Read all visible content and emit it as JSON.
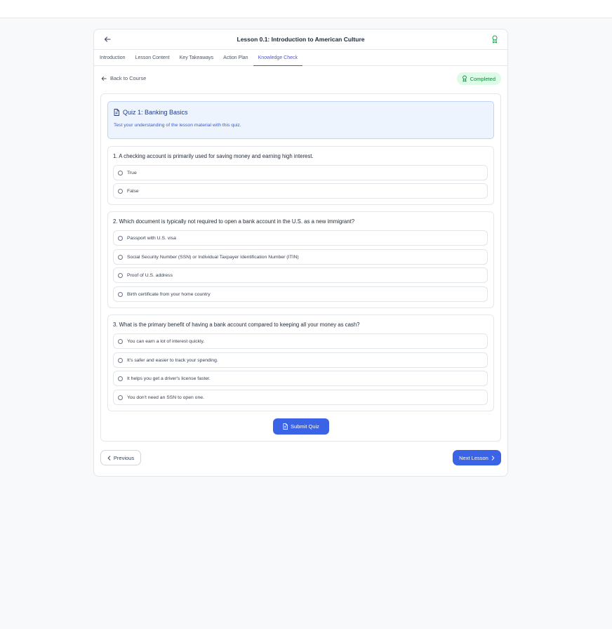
{
  "header": {
    "title": "Lesson 0.1: Introduction to American Culture"
  },
  "tabs": [
    {
      "label": "Introduction"
    },
    {
      "label": "Lesson Content"
    },
    {
      "label": "Key Takeaways"
    },
    {
      "label": "Action Plan"
    },
    {
      "label": "Knowledge Check",
      "active": true
    }
  ],
  "subbar": {
    "back_label": "Back to Course",
    "status_label": "Completed"
  },
  "quiz": {
    "title": "Quiz 1: Banking Basics",
    "description": "Test your understanding of the lesson material with this quiz.",
    "questions": [
      {
        "text": "1. A checking account is primarily used for saving money and earning high interest.",
        "options": [
          "True",
          "False"
        ]
      },
      {
        "text": "2. Which document is typically not required to open a bank account in the U.S. as a new immigrant?",
        "options": [
          "Passport with U.S. visa",
          "Social Security Number (SSN) or Individual Taxpayer Identification Number (ITIN)",
          "Proof of U.S. address",
          "Birth certificate from your home country"
        ]
      },
      {
        "text": "3. What is the primary benefit of having a bank account compared to keeping all your money as cash?",
        "options": [
          "You can earn a lot of interest quickly.",
          "It's safer and easier to track your spending.",
          "It helps you get a driver's license faster.",
          "You don't need an SSN to open one."
        ]
      }
    ],
    "submit_label": "Submit Quiz"
  },
  "nav": {
    "previous_label": "Previous",
    "next_label": "Next Lesson"
  },
  "colors": {
    "accent": "#3b63e6",
    "tab_active": "#4f57d9",
    "success_bg": "#dcfce7",
    "success_text": "#16803d"
  },
  "icons": {
    "back": "arrow-left-icon",
    "award": "award-icon",
    "document": "file-text-icon",
    "chevron_left": "chevron-left-icon",
    "chevron_right": "chevron-right-icon"
  }
}
